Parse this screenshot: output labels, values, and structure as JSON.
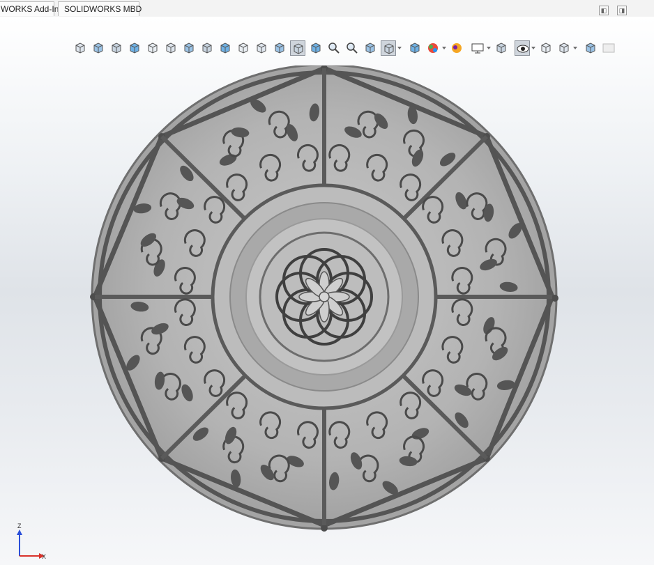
{
  "tabs": [
    {
      "label": "WORKS Add-Ins"
    },
    {
      "label": "SOLIDWORKS MBD"
    }
  ],
  "window_buttons": [
    {
      "name": "restore",
      "glyph": "◧"
    },
    {
      "name": "maximize",
      "glyph": "◨"
    }
  ],
  "heads_up_toolbar": [
    {
      "name": "isometric-view-icon"
    },
    {
      "name": "front-view-icon"
    },
    {
      "name": "section-view-icon"
    },
    {
      "name": "top-view-icon"
    },
    {
      "name": "right-view-icon"
    },
    {
      "name": "left-view-icon"
    },
    {
      "name": "bottom-view-icon"
    },
    {
      "name": "back-view-icon"
    },
    {
      "name": "normal-to-icon"
    },
    {
      "name": "dimetric-view-icon"
    },
    {
      "name": "trimetric-view-icon"
    },
    {
      "name": "shaded-icon"
    },
    {
      "name": "shaded-with-edges-icon",
      "active": true
    },
    {
      "name": "hidden-lines-icon"
    },
    {
      "name": "zoom-to-fit-icon"
    },
    {
      "name": "zoom-to-area-icon"
    },
    {
      "name": "wireframe-icon"
    },
    {
      "name": "display-style-icon",
      "active": true
    },
    {
      "name": "hide-show-items-icon"
    },
    {
      "name": "edit-appearance-icon"
    },
    {
      "name": "apply-scene-icon"
    },
    {
      "name": "view-settings-icon"
    },
    {
      "name": "view-orientation-icon"
    },
    {
      "name": "view-visibility-icon",
      "active": true
    },
    {
      "name": "appearance-icon"
    },
    {
      "name": "scenes-icon"
    },
    {
      "name": "display-pane-icon"
    },
    {
      "name": "realview-icon"
    }
  ],
  "triad": {
    "x_label": "X",
    "z_label": "Z"
  },
  "colors": {
    "model_dark": "#4e4e4e",
    "model_mid": "#8a8a8a",
    "model_light": "#b9b9b9",
    "active_button": "#cfd5dc",
    "triad_x": "#d9322b",
    "triad_z": "#2b4fd9"
  }
}
